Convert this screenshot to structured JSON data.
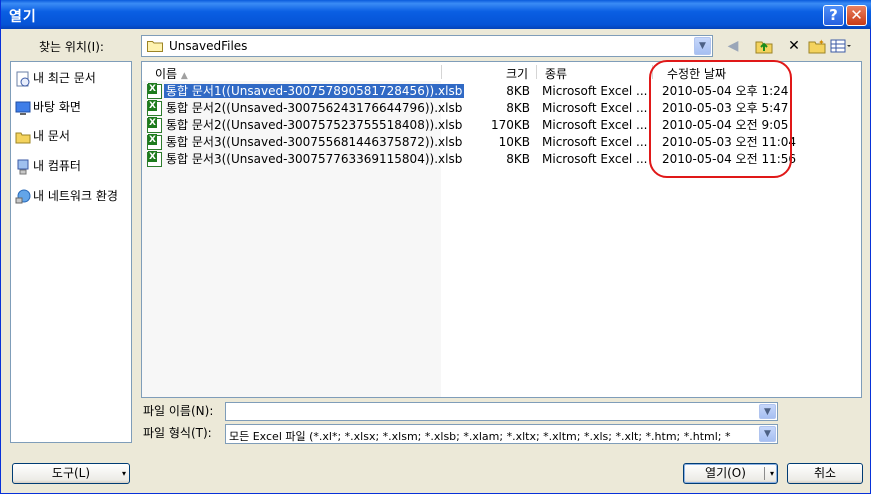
{
  "window": {
    "title": "열기",
    "help_glyph": "?",
    "close_glyph": "✕"
  },
  "lookin": {
    "label": "찾는 위치(I):",
    "value": "UnsavedFiles"
  },
  "toolbar": {
    "back": "◀",
    "up": "⬆",
    "delete": "✕",
    "newfolder": "✦",
    "views": "▦"
  },
  "places": [
    {
      "label": "내 최근 문서",
      "icon": "recent-documents-icon"
    },
    {
      "label": "바탕 화면",
      "icon": "desktop-icon"
    },
    {
      "label": "내 문서",
      "icon": "my-documents-icon"
    },
    {
      "label": "내 컴퓨터",
      "icon": "my-computer-icon"
    },
    {
      "label": "내 네트워크 환경",
      "icon": "network-icon"
    }
  ],
  "columns": {
    "name": "이름",
    "size": "크기",
    "type": "종류",
    "modified": "수정한 날짜"
  },
  "files": [
    {
      "name": "통합 문서1((Unsaved-300757890581728456)).xlsb",
      "size": "8KB",
      "type": "Microsoft Excel ...",
      "modified": "2010-05-04 오후 1:24"
    },
    {
      "name": "통합 문서2((Unsaved-300756243176644796)).xlsb",
      "size": "8KB",
      "type": "Microsoft Excel ...",
      "modified": "2010-05-03 오후 5:47"
    },
    {
      "name": "통합 문서2((Unsaved-300757523755518408)).xlsb",
      "size": "170KB",
      "type": "Microsoft Excel ...",
      "modified": "2010-05-04 오전 9:05"
    },
    {
      "name": "통합 문서3((Unsaved-300755681446375872)).xlsb",
      "size": "10KB",
      "type": "Microsoft Excel ...",
      "modified": "2010-05-03 오전 11:04"
    },
    {
      "name": "통합 문서3((Unsaved-300757763369115804)).xlsb",
      "size": "8KB",
      "type": "Microsoft Excel ...",
      "modified": "2010-05-04 오전 11:56"
    }
  ],
  "filename": {
    "label": "파일 이름(N):",
    "value": ""
  },
  "filetype": {
    "label": "파일 형식(T):",
    "value": "모든 Excel 파일 (*.xl*; *.xlsx; *.xlsm; *.xlsb; *.xlam; *.xltx; *.xltm; *.xls; *.xlt; *.htm; *.html; *"
  },
  "buttons": {
    "tools": "도구(L)",
    "open": "열기(O)",
    "cancel": "취소"
  },
  "colors": {
    "title_bar": "#0a5fe3",
    "selection": "#316ac5",
    "annotation": "#e01818"
  }
}
